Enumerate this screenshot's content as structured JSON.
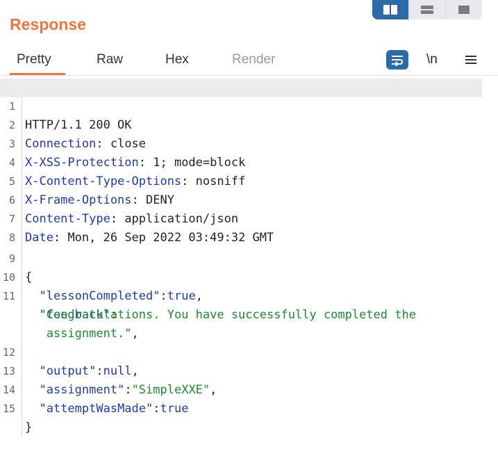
{
  "panel": {
    "title": "Response"
  },
  "tabs": {
    "pretty": "Pretty",
    "raw": "Raw",
    "hex": "Hex",
    "render": "Render"
  },
  "toolbar": {
    "newline_label": "\\n"
  },
  "colors": {
    "accent": "#f0763d",
    "toggle_active": "#2d6aa8",
    "header_key": "#1f3aa8",
    "json_string": "#1c8a2e"
  },
  "lines": {
    "l1": {
      "num": "1",
      "text": "HTTP/1.1 200 OK"
    },
    "l2": {
      "num": "2",
      "key": "Connection",
      "value": "close"
    },
    "l3": {
      "num": "3",
      "key": "X-XSS-Protection",
      "value": "1; mode=block"
    },
    "l4": {
      "num": "4",
      "key": "X-Content-Type-Options",
      "value": "nosniff"
    },
    "l5": {
      "num": "5",
      "key": "X-Frame-Options",
      "value": "DENY"
    },
    "l6": {
      "num": "6",
      "key": "Content-Type",
      "value": "application/json"
    },
    "l7": {
      "num": "7",
      "key": "Date",
      "value": "Mon, 26 Sep 2022 03:49:32 GMT"
    },
    "l8": {
      "num": "8"
    },
    "l9": {
      "num": "9",
      "text": "{"
    },
    "l10": {
      "num": "10",
      "key": "\"lessonCompleted\"",
      "value": "true"
    },
    "l11": {
      "num": "11",
      "key": "\"feedback\""
    },
    "l11a": {
      "value": "\"Congratulations. You have successfully completed the"
    },
    "l11b": {
      "value": "assignment.\""
    },
    "l12": {
      "num": "12",
      "key": "\"output\"",
      "value": "null"
    },
    "l13": {
      "num": "13",
      "key": "\"assignment\"",
      "value": "\"SimpleXXE\""
    },
    "l14": {
      "num": "14",
      "key": "\"attemptWasMade\"",
      "value": "true"
    },
    "l15": {
      "num": "15",
      "text": "}"
    }
  }
}
